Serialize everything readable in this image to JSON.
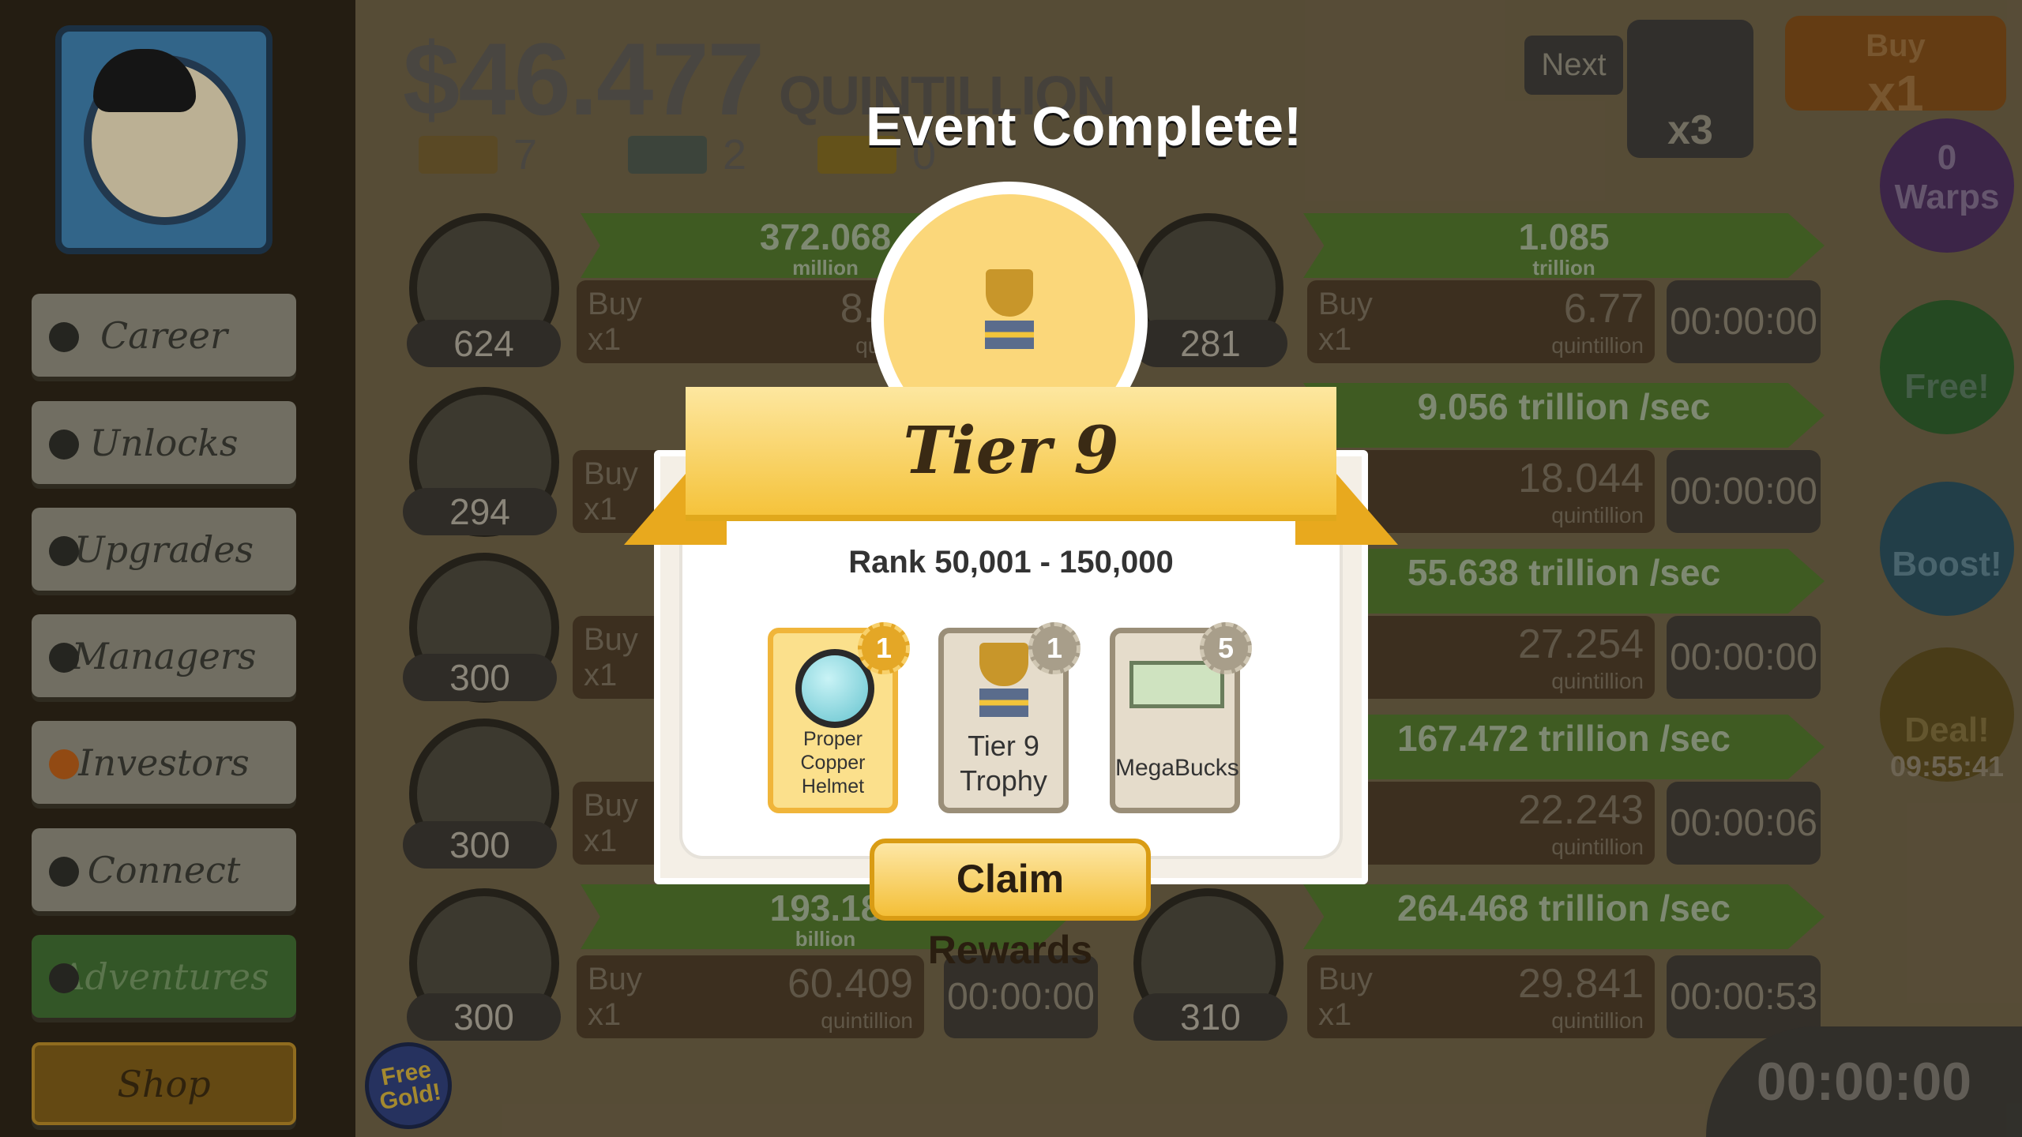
{
  "hud": {
    "money_value": "$46.477",
    "money_unit": "QUINTILLION",
    "gold_count": "7",
    "megabucks_count": "2",
    "ticket_count": "0",
    "next_label": "Next",
    "multiplier": "x3",
    "buy_label": "Buy",
    "buy_amount": "x1",
    "warps_count": "0",
    "warps_label": "Warps",
    "free_label": "Free!",
    "boost_label": "Boost!",
    "deal_label": "Deal!",
    "deal_timer": "09:55:41",
    "corner_timer": "00:00:00",
    "free_gold_label": "Free Gold!"
  },
  "sidebar": {
    "items": [
      {
        "label": "Career"
      },
      {
        "label": "Unlocks"
      },
      {
        "label": "Upgrades"
      },
      {
        "label": "Managers"
      },
      {
        "label": "Investors"
      },
      {
        "label": "Connect"
      },
      {
        "label": "Adventures"
      },
      {
        "label": "Shop"
      }
    ]
  },
  "businesses_left": [
    {
      "count": "624",
      "bar_value": "372.068",
      "bar_unit": "million",
      "buy": "Buy",
      "buy_qty": "x1",
      "price": "8.0",
      "price_unit": "quin"
    },
    {
      "count": "294",
      "buy": "Buy",
      "buy_qty": "x1"
    },
    {
      "count": "300",
      "buy": "Buy",
      "buy_qty": "x1"
    },
    {
      "count": "300",
      "buy": "Buy",
      "buy_qty": "x1"
    },
    {
      "count": "300",
      "bar_value": "193.18",
      "bar_unit": "billion",
      "buy": "Buy",
      "buy_qty": "x1",
      "price": "60.409",
      "price_unit": "quintillion",
      "timer": "00:00:00"
    }
  ],
  "businesses_right": [
    {
      "count": "281",
      "bar_value": "1.085",
      "bar_unit": "trillion",
      "buy": "Buy",
      "buy_qty": "x1",
      "price": "6.77",
      "price_unit": "quintillion",
      "timer": "00:00:00"
    },
    {
      "bar_value": "9.056 trillion /sec",
      "price": "18.044",
      "price_unit": "quintillion",
      "timer": "00:00:00"
    },
    {
      "bar_value": "55.638 trillion /sec",
      "price": "27.254",
      "price_unit": "quintillion",
      "timer": "00:00:00"
    },
    {
      "bar_value": "167.472 trillion /sec",
      "price": "22.243",
      "price_unit": "quintillion",
      "timer": "00:00:06"
    },
    {
      "count": "310",
      "bar_value": "264.468 trillion /sec",
      "buy": "Buy",
      "buy_qty": "x1",
      "price": "29.841",
      "price_unit": "quintillion",
      "timer": "00:00:53"
    }
  ],
  "modal": {
    "title": "Event Complete!",
    "tier": "Tier 9",
    "rank": "Rank 50,001 - 150,000",
    "rewards": [
      {
        "name_line1": "Proper",
        "name_line2": "Copper",
        "name_line3": "Helmet",
        "quantity": "1",
        "icon": "helmet-icon"
      },
      {
        "name_line1": "Tier 9",
        "name_line2": "Trophy",
        "quantity": "1",
        "icon": "trophy-icon"
      },
      {
        "name_line1": "MegaBucks",
        "quantity": "5",
        "icon": "megabucks-icon"
      }
    ],
    "claim_label": "Claim Rewards",
    "colors": {
      "gold": "#f4bf37",
      "banner": "#fde7a0",
      "panel": "#f4efe6"
    }
  }
}
